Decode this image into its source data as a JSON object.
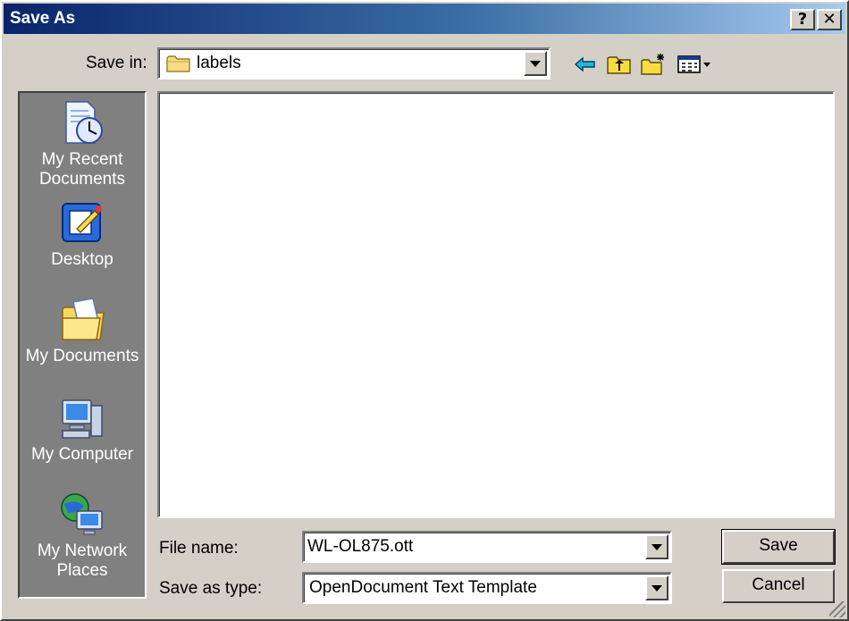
{
  "window": {
    "title": "Save As",
    "help_symbol": "?",
    "close_symbol": "✕"
  },
  "save_in": {
    "label": "Save in:",
    "value": "labels"
  },
  "toolbar": {
    "icons": [
      "back-arrow-icon",
      "up-folder-icon",
      "new-folder-icon",
      "view-menu-icon"
    ]
  },
  "places": [
    {
      "label": "My Recent Documents",
      "icon": "recent-documents-icon"
    },
    {
      "label": "Desktop",
      "icon": "desktop-icon"
    },
    {
      "label": "My Documents",
      "icon": "my-documents-icon"
    },
    {
      "label": "My Computer",
      "icon": "my-computer-icon"
    },
    {
      "label": "My Network Places",
      "icon": "network-places-icon"
    }
  ],
  "file_name": {
    "label": "File name:",
    "value": "WL-OL875.ott"
  },
  "save_as_type": {
    "label": "Save as type:",
    "value": "OpenDocument Text Template"
  },
  "buttons": {
    "save": "Save",
    "cancel": "Cancel"
  },
  "colors": {
    "title_gradient_start": "#0a246a",
    "title_gradient_end": "#a6caf0",
    "face": "#d4d0c8",
    "places_bar": "#808080"
  }
}
